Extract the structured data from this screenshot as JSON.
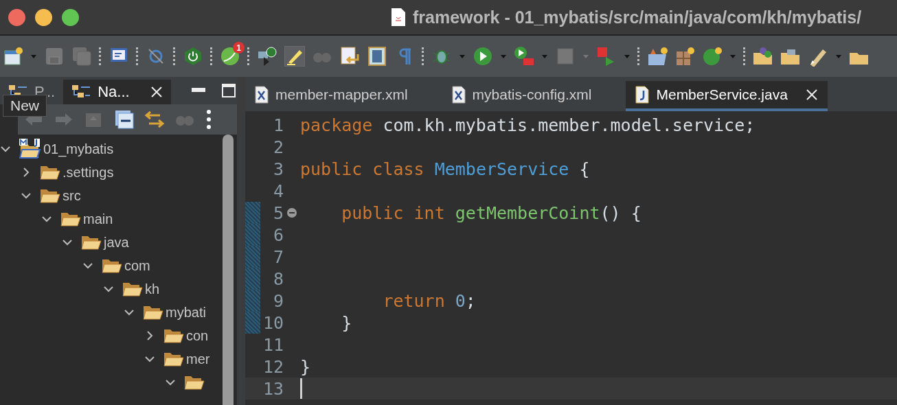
{
  "window": {
    "title": "framework - 01_mybatis/src/main/java/com/kh/mybatis/"
  },
  "toolbar": {
    "badge": "1"
  },
  "tooltip": "New",
  "left_panel": {
    "tabs": [
      {
        "label": "P...",
        "selected": false
      },
      {
        "label": "Na...",
        "selected": true
      }
    ]
  },
  "tree": [
    {
      "label": "01_mybatis",
      "kind": "project",
      "expanded": true,
      "children": [
        {
          "label": ".settings",
          "kind": "folder",
          "expanded": false
        },
        {
          "label": "src",
          "kind": "folder",
          "expanded": true,
          "children": [
            {
              "label": "main",
              "kind": "folder",
              "expanded": true,
              "children": [
                {
                  "label": "java",
                  "kind": "folder",
                  "expanded": true,
                  "children": [
                    {
                      "label": "com",
                      "kind": "folder",
                      "expanded": true,
                      "children": [
                        {
                          "label": "kh",
                          "kind": "folder",
                          "expanded": true,
                          "children": [
                            {
                              "label": "mybati",
                              "kind": "folder",
                              "expanded": true,
                              "children": [
                                {
                                  "label": "con",
                                  "kind": "folder",
                                  "expanded": false
                                },
                                {
                                  "label": "mer",
                                  "kind": "folder",
                                  "expanded": true,
                                  "children": [
                                    {
                                      "kind": "folder",
                                      "expanded": true
                                    }
                                  ]
                                }
                              ]
                            }
                          ]
                        }
                      ]
                    }
                  ]
                }
              ]
            }
          ]
        }
      ]
    }
  ],
  "editor": {
    "tabs": [
      {
        "label": "member-mapper.xml",
        "kind": "xml",
        "selected": false
      },
      {
        "label": "mybatis-config.xml",
        "kind": "xml",
        "selected": false
      },
      {
        "label": "MemberService.java",
        "kind": "java",
        "selected": true
      }
    ],
    "lines": [
      {
        "number": "1",
        "changed": false,
        "fold": false,
        "current": false,
        "tokens": [
          {
            "kind": "keyword",
            "text": "package"
          },
          {
            "kind": "plain",
            "text": " com.kh.mybatis.member.model.service;"
          }
        ]
      },
      {
        "number": "2",
        "changed": false,
        "fold": false,
        "current": false
      },
      {
        "number": "3",
        "changed": false,
        "fold": false,
        "current": false,
        "tokens": [
          {
            "kind": "keyword",
            "text": "public class "
          },
          {
            "kind": "type",
            "text": "MemberService"
          },
          {
            "kind": "plain",
            "text": " {"
          }
        ]
      },
      {
        "number": "4",
        "changed": false,
        "fold": false,
        "current": false
      },
      {
        "number": "5",
        "changed": true,
        "fold": true,
        "current": false,
        "tokens": [
          {
            "kind": "keyword",
            "text": "    public int "
          },
          {
            "kind": "method",
            "text": "getMemberCoint"
          },
          {
            "kind": "plain",
            "text": "() {"
          }
        ]
      },
      {
        "number": "6",
        "changed": true,
        "fold": false,
        "current": false
      },
      {
        "number": "7",
        "changed": true,
        "fold": false,
        "current": false
      },
      {
        "number": "8",
        "changed": true,
        "fold": false,
        "current": false
      },
      {
        "number": "9",
        "changed": true,
        "fold": false,
        "current": false,
        "tokens": [
          {
            "kind": "keyword",
            "text": "        return "
          },
          {
            "kind": "number",
            "text": "0"
          },
          {
            "kind": "plain",
            "text": ";"
          }
        ]
      },
      {
        "number": "10",
        "changed": true,
        "fold": false,
        "current": false,
        "tokens": [
          {
            "kind": "plain",
            "text": "    }"
          }
        ]
      },
      {
        "number": "11",
        "changed": false,
        "fold": false,
        "current": false
      },
      {
        "number": "12",
        "changed": false,
        "fold": false,
        "current": false,
        "tokens": [
          {
            "kind": "plain",
            "text": "}"
          }
        ]
      },
      {
        "number": "13",
        "changed": false,
        "fold": false,
        "current": true
      }
    ]
  }
}
